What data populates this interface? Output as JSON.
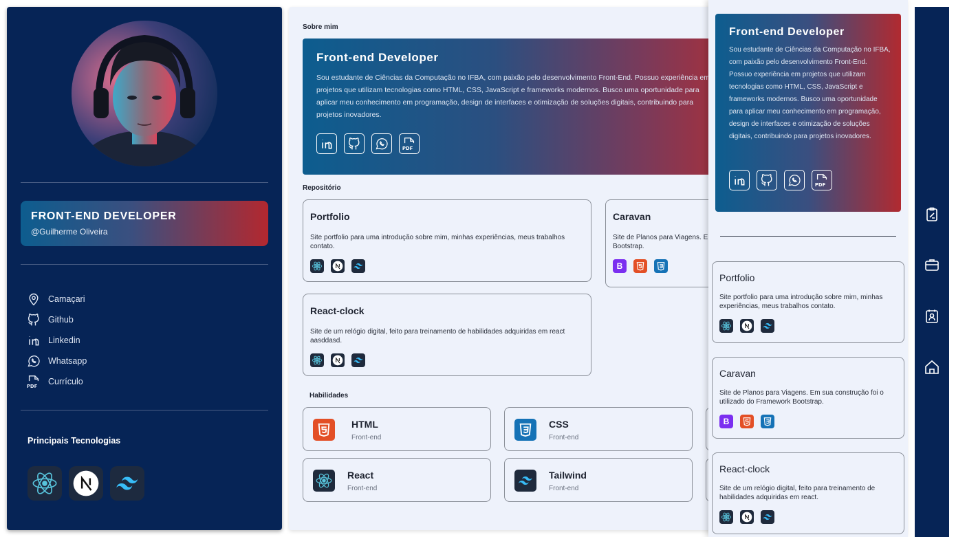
{
  "profile": {
    "role": "FRONT-END DEVELOPER",
    "handle": "@Guilherme Oliveira",
    "links": [
      {
        "label": "Camaçari",
        "icon": "location-pin-icon"
      },
      {
        "label": "Github",
        "icon": "github-icon"
      },
      {
        "label": "Linkedin",
        "icon": "linkedin-icon"
      },
      {
        "label": "Whatsapp",
        "icon": "whatsapp-icon"
      },
      {
        "label": "Currículo",
        "icon": "pdf-icon"
      }
    ],
    "tech_title": "Principais Tecnologias",
    "technologies": [
      "react-icon",
      "nextjs-icon",
      "tailwind-icon"
    ]
  },
  "main": {
    "about_label": "Sobre mim",
    "about_title": "Front-end Developer",
    "about_text": "Sou estudante de Ciências da Computação no IFBA, com paixão pelo desenvolvimento Front-End. Possuo experiência em projetos que utilizam tecnologias como HTML, CSS, JavaScript e frameworks modernos. Busco uma oportunidade para aplicar meu conhecimento em programação, design de interfaces e otimização de soluções digitais, contribuindo para projetos inovadores.",
    "social_icons": [
      "linkedin-icon",
      "github-icon",
      "whatsapp-icon",
      "pdf-icon"
    ],
    "repo_label": "Repositório",
    "repos": [
      {
        "name": "Portfolio",
        "desc": "Site portfolio para uma introdução sobre mim, minhas experiências, meus trabalhos contato.",
        "icons": [
          "react",
          "next",
          "tailwind"
        ]
      },
      {
        "name": "Caravan",
        "desc": "Site de Planos para Viagens. E Bootstrap.",
        "icons": [
          "bootstrap",
          "html",
          "css"
        ]
      },
      {
        "name": "React-clock",
        "desc": "Site de um relógio digital, feito para treinamento de habilidades adquiridas em react aasddasd.",
        "icons": [
          "react",
          "next",
          "tailwind"
        ]
      }
    ],
    "skills_label": "Habilidades",
    "skills": [
      {
        "name": "HTML",
        "sub": "Front-end",
        "icon": "html5-icon"
      },
      {
        "name": "CSS",
        "sub": "Front-end",
        "icon": "css3-icon"
      },
      {
        "name": "React",
        "sub": "Front-end",
        "icon": "react-icon"
      },
      {
        "name": "Tailwind",
        "sub": "Front-end",
        "icon": "tailwind-icon"
      }
    ]
  },
  "panel": {
    "about_title": "Front-end Developer",
    "about_text": "Sou estudante de Ciências da Computação no IFBA, com paixão pelo desenvolvimento Front-End. Possuo experiência em projetos que utilizam tecnologias como HTML, CSS, JavaScript e frameworks modernos. Busco uma oportunidade para aplicar meu conhecimento em programação, design de interfaces e otimização de soluções digitais, contribuindo para projetos inovadores.",
    "repos": [
      {
        "name": "Portfolio",
        "desc": "Site portfolio para uma introdução sobre mim, minhas experiências, meus trabalhos contato."
      },
      {
        "name": "Caravan",
        "desc": "Site de Planos para Viagens. Em sua construção foi o utilizado do Framework Bootstrap."
      },
      {
        "name": "React-clock",
        "desc": "Site de um relógio digital, feito para treinamento de habilidades adquiridas em react."
      }
    ]
  },
  "nav": [
    "clipboard-icon",
    "briefcase-icon",
    "contact-card-icon",
    "home-icon"
  ],
  "colors": {
    "navy": "#062456",
    "gradient_start": "#0d5d8f",
    "gradient_end": "#b3282f",
    "page_bg": "#eef2fb"
  }
}
